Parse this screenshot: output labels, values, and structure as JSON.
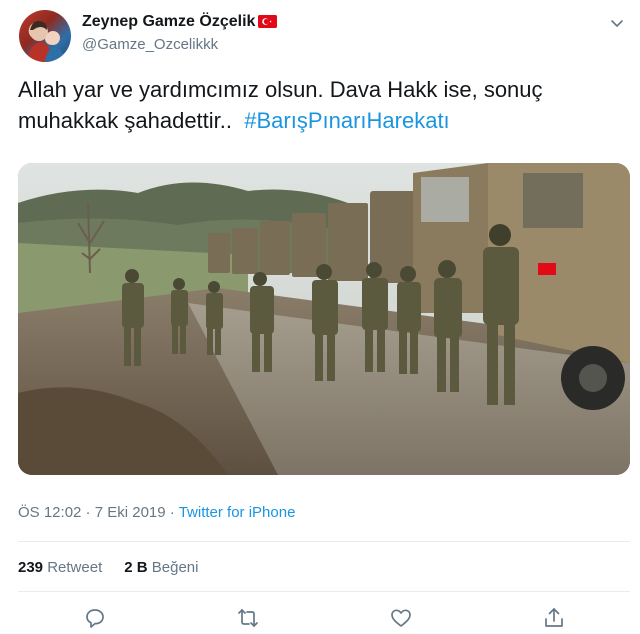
{
  "author": {
    "display_name": "Zeynep Gamze Özçelik",
    "handle": "@Gamze_Ozcelikkk",
    "flag_icon": "turkey-flag-icon"
  },
  "tweet": {
    "text": "Allah yar ve yardımcımız olsun. Dava Hakk ise, sonuç muhakkak şahadettir..",
    "hashtag": "#BarışPınarıHarekatı"
  },
  "meta": {
    "time": "ÖS 12:02",
    "separator": " · ",
    "date": "7 Eki 2019",
    "via": "Twitter for iPhone"
  },
  "stats": {
    "retweets_count": "239",
    "retweets_label": "Retweet",
    "likes_count": "2 B",
    "likes_label": "Beğeni"
  },
  "actions": [
    "reply-icon",
    "retweet-icon",
    "like-icon",
    "share-icon"
  ],
  "colors": {
    "link": "#1b95e0",
    "secondary_text": "#657786",
    "primary_text": "#14171a",
    "flag_red": "#e30a17"
  }
}
